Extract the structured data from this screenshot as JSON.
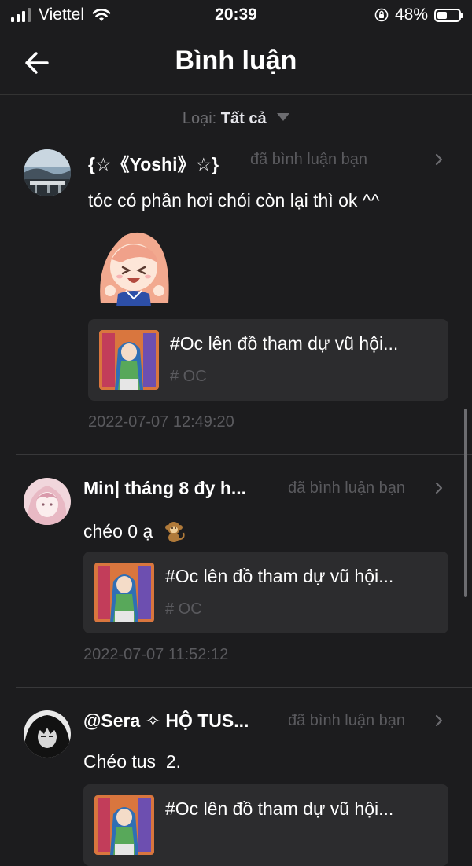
{
  "status_bar": {
    "carrier": "Viettel",
    "time": "20:39",
    "battery_percent": "48%",
    "battery_level": 0.48
  },
  "header": {
    "title": "Bình luận"
  },
  "filter": {
    "label": "Loại:",
    "value": "Tất cả"
  },
  "comments": [
    {
      "username": "{☆《Yoshi》☆}",
      "action": "đã bình luận bạn",
      "text": "tóc có phần hơi chói còn lại thì ok ^^",
      "post": {
        "title": "#Oc lên đồ tham dự vũ hội...",
        "tag": "# OC"
      },
      "timestamp": "2022-07-07 12:49:20"
    },
    {
      "username": "Min| tháng 8 đy h...",
      "action": "đã bình luận bạn",
      "text": "chéo 0 ạ",
      "post": {
        "title": "#Oc lên đồ tham dự vũ hội...",
        "tag": "# OC"
      },
      "timestamp": "2022-07-07 11:52:12"
    },
    {
      "username": "@Sera ✧ HỘ TUS...",
      "action": "đã bình luận bạn",
      "text": "Chéo tus  2.",
      "post": {
        "title": "#Oc lên đồ tham dự vũ hội..."
      }
    }
  ]
}
